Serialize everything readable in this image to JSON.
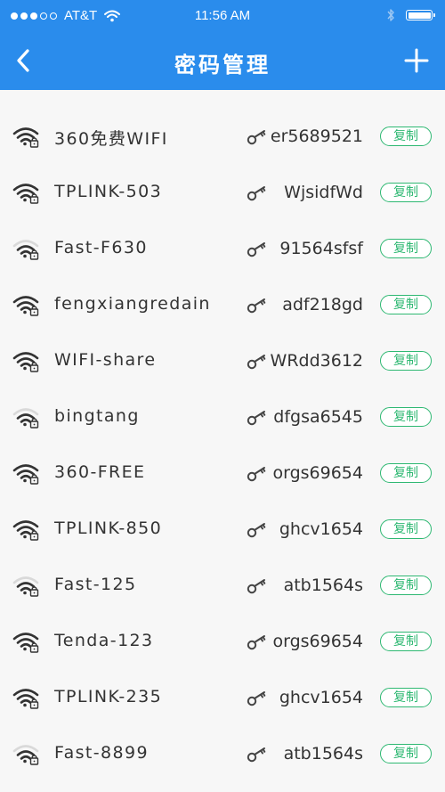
{
  "status_bar": {
    "carrier": "AT&T",
    "time": "11:56 AM",
    "signal_dots_filled": 3,
    "signal_dots_total": 5,
    "battery_level": 1.0
  },
  "nav": {
    "title": "密码管理",
    "back_icon": "chevron-left-icon",
    "add_icon": "plus-icon"
  },
  "colors": {
    "header_bg": "#2a8cec",
    "copy_button": "#2eb872",
    "background": "#f7f7f7"
  },
  "wifi_list": [
    {
      "ssid": "360免费WIFI",
      "password": "er5689521",
      "copy_label": "复制",
      "signal": "full"
    },
    {
      "ssid": "TPLINK-503",
      "password": "WjsidfWd",
      "copy_label": "复制",
      "signal": "full"
    },
    {
      "ssid": "Fast-F630",
      "password": "91564sfsf",
      "copy_label": "复制",
      "signal": "weak"
    },
    {
      "ssid": "fengxiangredain",
      "password": "adf218gd",
      "copy_label": "复制",
      "signal": "full"
    },
    {
      "ssid": "WIFI-share",
      "password": "WRdd3612",
      "copy_label": "复制",
      "signal": "full"
    },
    {
      "ssid": "bingtang",
      "password": "dfgsa6545",
      "copy_label": "复制",
      "signal": "weak"
    },
    {
      "ssid": "360-FREE",
      "password": "orgs69654",
      "copy_label": "复制",
      "signal": "full"
    },
    {
      "ssid": "TPLINK-850",
      "password": "ghcv1654",
      "copy_label": "复制",
      "signal": "full"
    },
    {
      "ssid": "Fast-125",
      "password": "atb1564s",
      "copy_label": "复制",
      "signal": "weak"
    },
    {
      "ssid": "Tenda-123",
      "password": "orgs69654",
      "copy_label": "复制",
      "signal": "full"
    },
    {
      "ssid": "TPLINK-235",
      "password": "ghcv1654",
      "copy_label": "复制",
      "signal": "full"
    },
    {
      "ssid": "Fast-8899",
      "password": "atb1564s",
      "copy_label": "复制",
      "signal": "weak"
    }
  ]
}
